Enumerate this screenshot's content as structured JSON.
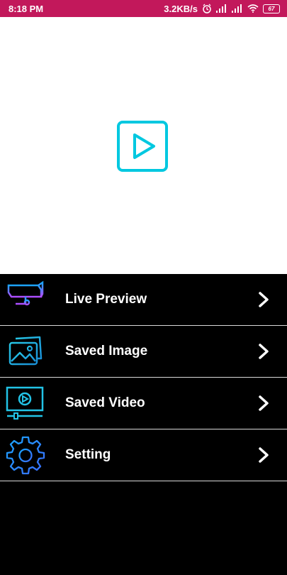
{
  "status_bar": {
    "time": "8:18 PM",
    "network_speed": "3.2KB/s",
    "battery_level": "67",
    "icons": [
      "alarm-icon",
      "signal-icon",
      "signal-icon",
      "wifi-icon",
      "battery-icon"
    ]
  },
  "hero": {
    "icon": "play-icon",
    "accent_color": "#00c8e0"
  },
  "menu": {
    "items": [
      {
        "label": "Live Preview",
        "icon": "cctv-camera-icon"
      },
      {
        "label": "Saved Image",
        "icon": "gallery-icon"
      },
      {
        "label": "Saved Video",
        "icon": "video-player-icon"
      },
      {
        "label": "Setting",
        "icon": "gear-icon"
      }
    ],
    "chevron_icon": "chevron-right-icon"
  },
  "colors": {
    "status_bar": "#c2185b",
    "menu_background": "#000000",
    "hero_background": "#ffffff",
    "text": "#ffffff"
  }
}
